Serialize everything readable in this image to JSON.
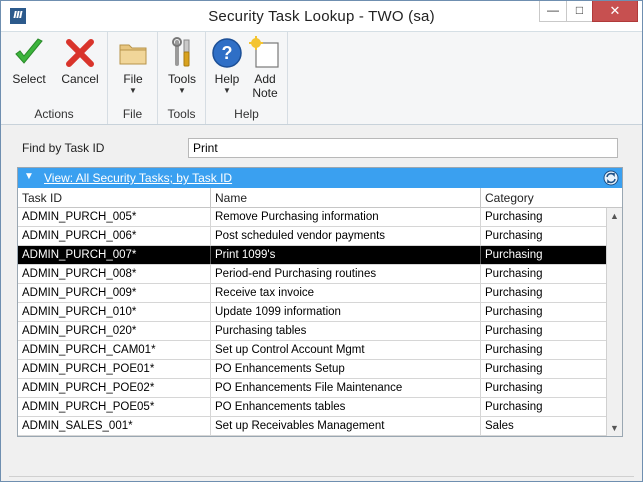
{
  "window": {
    "title": "Security Task Lookup  -  TWO (sa)",
    "app_icon": "Ⅲ",
    "min_glyph": "—",
    "max_glyph": "□",
    "close_glyph": "✕"
  },
  "ribbon": {
    "actions": {
      "label": "Actions",
      "select": "Select",
      "cancel": "Cancel"
    },
    "file": {
      "label": "File",
      "file": "File"
    },
    "tools": {
      "label": "Tools",
      "tools": "Tools"
    },
    "help": {
      "label": "Help",
      "help": "Help",
      "add_note_line1": "Add",
      "add_note_line2": "Note"
    },
    "caret": "▼"
  },
  "find": {
    "label": "Find by Task ID",
    "value": "Print"
  },
  "grid": {
    "view_caret": "▼",
    "view_label": "View: All Security Tasks; by Task ID",
    "columns": [
      "Task ID",
      "Name",
      "Category"
    ],
    "rows": [
      [
        "ADMIN_PURCH_005*",
        "Remove Purchasing information",
        "Purchasing"
      ],
      [
        "ADMIN_PURCH_006*",
        "Post scheduled vendor payments",
        "Purchasing"
      ],
      [
        "ADMIN_PURCH_007*",
        "Print 1099's",
        "Purchasing"
      ],
      [
        "ADMIN_PURCH_008*",
        "Period-end Purchasing routines",
        "Purchasing"
      ],
      [
        "ADMIN_PURCH_009*",
        "Receive tax invoice",
        "Purchasing"
      ],
      [
        "ADMIN_PURCH_010*",
        "Update 1099 information",
        "Purchasing"
      ],
      [
        "ADMIN_PURCH_020*",
        "Purchasing tables",
        "Purchasing"
      ],
      [
        "ADMIN_PURCH_CAM01*",
        "Set up Control Account Mgmt",
        "Purchasing"
      ],
      [
        "ADMIN_PURCH_POE01*",
        "PO Enhancements Setup",
        "Purchasing"
      ],
      [
        "ADMIN_PURCH_POE02*",
        "PO Enhancements File Maintenance",
        "Purchasing"
      ],
      [
        "ADMIN_PURCH_POE05*",
        "PO Enhancements tables",
        "Purchasing"
      ],
      [
        "ADMIN_SALES_001*",
        "Set up Receivables Management",
        "Sales"
      ]
    ],
    "selected_row_index": 2,
    "scroll_up": "▲",
    "scroll_down": "▼"
  }
}
